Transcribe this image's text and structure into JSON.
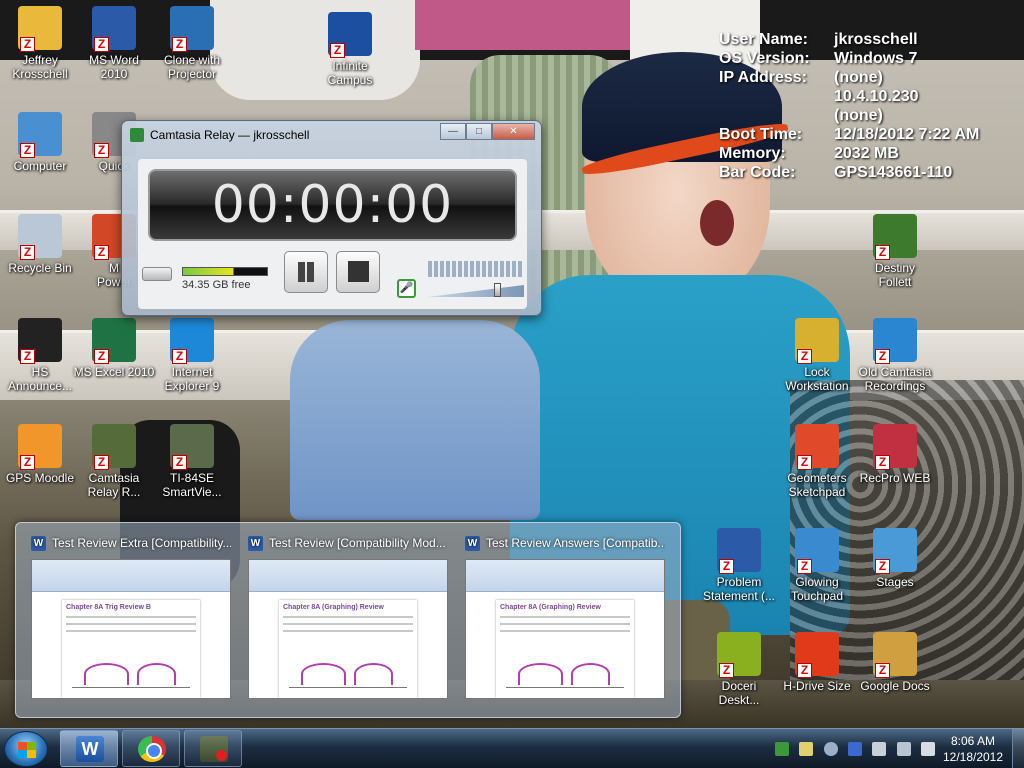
{
  "desktop_icons": [
    {
      "label": "Jeffrey\nKrosschell",
      "icon": "user-folder-icon",
      "color": "#e8b93a"
    },
    {
      "label": "MS Word\n2010",
      "icon": "word-icon",
      "color": "#2b5aa8"
    },
    {
      "label": "Clone with\nProjector",
      "icon": "windows-clone-icon",
      "color": "#2a6fb4"
    },
    {
      "label": "Infinite\nCampus",
      "icon": "infinite-campus-icon",
      "color": "#1d4fa0"
    },
    {
      "label": "Computer",
      "icon": "computer-icon",
      "color": "#4a8fd0"
    },
    {
      "label": "Quick",
      "icon": "quick-icon",
      "color": "#888888"
    },
    {
      "label": "Recycle Bin",
      "icon": "recycle-bin-icon",
      "color": "#b9c7d6"
    },
    {
      "label": "M\nPower",
      "icon": "powerpoint-icon",
      "color": "#d24726"
    },
    {
      "label": "HS\nAnnounce...",
      "icon": "hs-announce-icon",
      "color": "#222222"
    },
    {
      "label": "MS Excel 2010",
      "icon": "excel-icon",
      "color": "#1f7244"
    },
    {
      "label": "Internet\nExplorer 9",
      "icon": "internet-explorer-icon",
      "color": "#1e88d8"
    },
    {
      "label": "GPS Moodle",
      "icon": "moodle-icon",
      "color": "#f0962a"
    },
    {
      "label": "Camtasia\nRelay R...",
      "icon": "camtasia-relay-icon",
      "color": "#556b3a"
    },
    {
      "label": "TI-84SE\nSmartVie...",
      "icon": "ti84-icon",
      "color": "#5a6a4a"
    },
    {
      "label": "Destiny\nFollett",
      "icon": "destiny-tree-icon",
      "color": "#3e7a2e"
    },
    {
      "label": "Lock\nWorkstation",
      "icon": "lock-icon",
      "color": "#d8b030"
    },
    {
      "label": "Old Camtasia\nRecordings",
      "icon": "globe-icon",
      "color": "#2a86d0"
    },
    {
      "label": "Geometers\nSketchpad",
      "icon": "sketchpad-icon",
      "color": "#e04a2a"
    },
    {
      "label": "RecPro WEB",
      "icon": "recpro-icon",
      "color": "#c03040"
    },
    {
      "label": "Problem\nStatement (...",
      "icon": "word-doc-icon",
      "color": "#2b5aa8"
    },
    {
      "label": "Glowing\nTouchpad",
      "icon": "touchpad-icon",
      "color": "#3a8ad0"
    },
    {
      "label": "Stages",
      "icon": "stages-icon",
      "color": "#4a9ad8"
    },
    {
      "label": "Doceri\nDeskt...",
      "icon": "doceri-icon",
      "color": "#8ab020"
    },
    {
      "label": "H-Drive Size",
      "icon": "pie-chart-icon",
      "color": "#e03a1a"
    },
    {
      "label": "Google Docs",
      "icon": "google-docs-icon",
      "color": "#d0a040"
    }
  ],
  "bginfo": [
    {
      "key": "User Name:",
      "value": "jkrosschell"
    },
    {
      "key": "OS Version:",
      "value": "Windows 7"
    },
    {
      "key": "IP Address:",
      "value": "(none)"
    },
    {
      "key": "",
      "value": "10.4.10.230"
    },
    {
      "key": "",
      "value": "(none)"
    },
    {
      "key": "Boot Time:",
      "value": "12/18/2012 7:22 AM"
    },
    {
      "key": "Memory:",
      "value": "2032 MB"
    },
    {
      "key": "Bar Code:",
      "value": "GPS143661-110"
    }
  ],
  "camtasia": {
    "title": "Camtasia Relay — jkrosschell",
    "timer": "00:00:00",
    "disk_free": "34.35 GB free"
  },
  "preview": {
    "thumbs": [
      {
        "title": "Test Review Extra [Compatibility...",
        "doc_heading": "Chapter 8A Trig Review B"
      },
      {
        "title": "Test Review [Compatibility Mod...",
        "doc_heading": "Chapter 8A (Graphing) Review"
      },
      {
        "title": "Test Review Answers [Compatib...",
        "doc_heading": "Chapter 8A (Graphing) Review"
      }
    ]
  },
  "taskbar": {
    "buttons": [
      "word-taskbar-icon",
      "chrome-icon",
      "camtasia-recorder-icon"
    ],
    "clock_time": "8:06 AM",
    "clock_date": "12/18/2012"
  }
}
